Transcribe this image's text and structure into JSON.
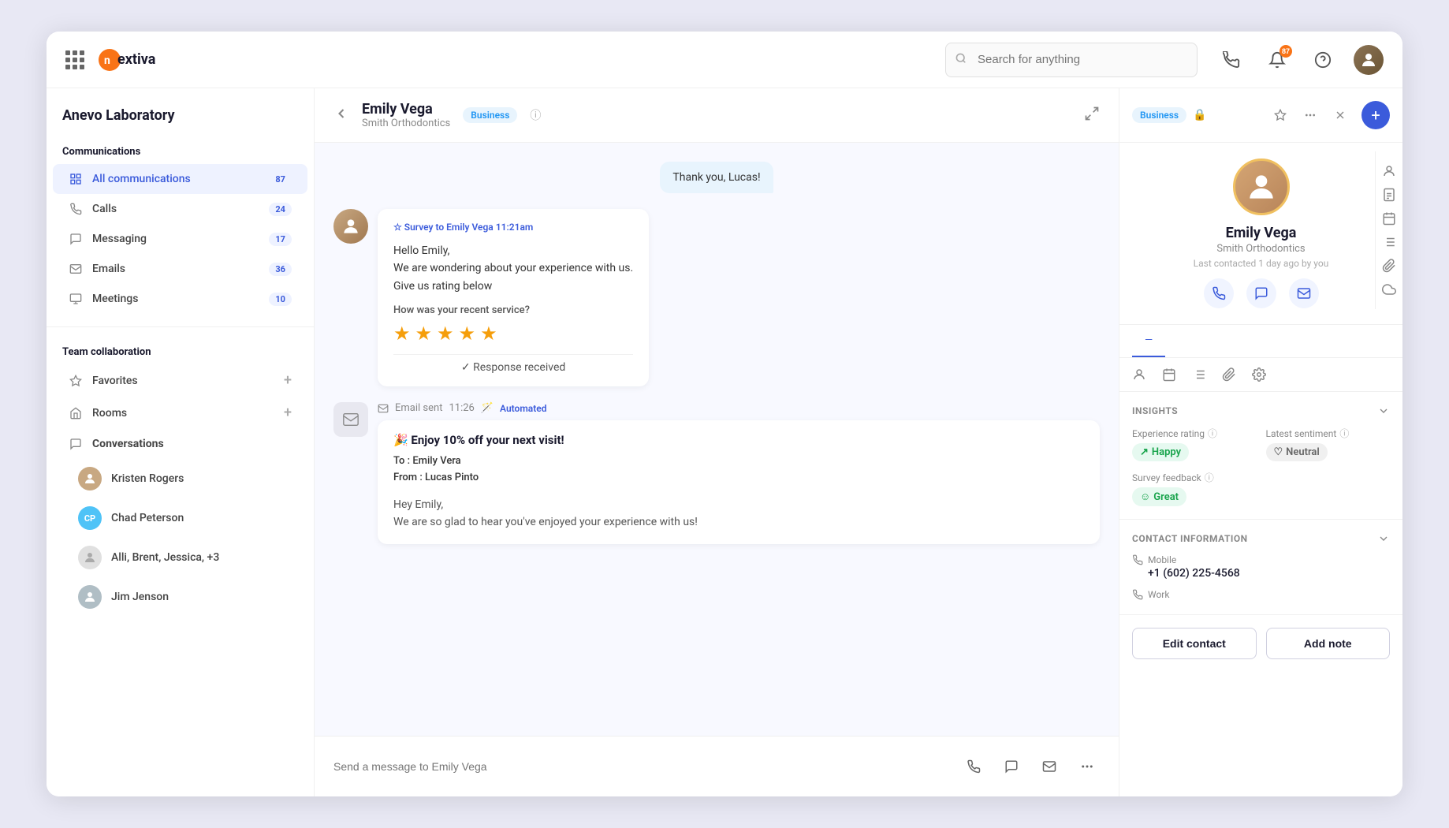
{
  "app": {
    "logo_text_start": "ne",
    "logo_text_orange": "x",
    "logo_text_end": "tiva"
  },
  "topnav": {
    "search_placeholder": "Search for anything",
    "notification_count": "87"
  },
  "sidebar": {
    "workspace": "Anevo Laboratory",
    "communications_title": "Communications",
    "items_comm": [
      {
        "label": "All communications",
        "badge": "87",
        "active": true
      },
      {
        "label": "Calls",
        "badge": "24"
      },
      {
        "label": "Messaging",
        "badge": "17"
      },
      {
        "label": "Emails",
        "badge": "36"
      },
      {
        "label": "Meetings",
        "badge": "10"
      }
    ],
    "team_collab_title": "Team collaboration",
    "favorites_label": "Favorites",
    "rooms_label": "Rooms",
    "conversations_label": "Conversations",
    "conversations": [
      {
        "name": "Kristen Rogers",
        "avatar_color": "#c8a882",
        "avatar_type": "image"
      },
      {
        "name": "Chad Peterson",
        "avatar_color": "#4fc3f7",
        "avatar_type": "initials",
        "initials": "CP"
      },
      {
        "name": "Alli, Brent, Jessica, +3",
        "avatar_type": "image"
      },
      {
        "name": "Jim Jenson",
        "avatar_type": "image"
      }
    ]
  },
  "chat": {
    "contact_name": "Emily Vega",
    "contact_org": "Smith Orthodontics",
    "business_label": "Business",
    "msg_outgoing": "Thank you, Lucas!",
    "survey_label": "Survey to",
    "survey_to": "Emily Vega",
    "survey_time": "11:21am",
    "survey_greeting": "Hello Emily,",
    "survey_line1": "We are wondering about your experience with us.",
    "survey_line2": "Give us rating below",
    "survey_question": "How was your recent service?",
    "stars_count": 5,
    "response_received": "✓ Response received",
    "email_label": "Email sent",
    "email_time": "11:26",
    "automated_label": "Automated",
    "email_subject": "🎉 Enjoy 10% off your next visit!",
    "email_to_label": "To :",
    "email_to": "Emily Vera",
    "email_from_label": "From :",
    "email_from": "Lucas Pinto",
    "email_body_line1": "Hey Emily,",
    "email_body_line2": "We are so glad to hear you've enjoyed your experience with us!",
    "input_placeholder": "Send a message to Emily Vega"
  },
  "right_panel": {
    "business_label": "Business",
    "contact_name": "Emily Vega",
    "contact_org": "Smith Orthodontics",
    "last_contacted": "Last contacted 1 day ago by you",
    "insights_title": "INSIGHTS",
    "experience_rating_label": "Experience rating",
    "experience_rating_value": "Happy",
    "latest_sentiment_label": "Latest sentiment",
    "latest_sentiment_value": "Neutral",
    "survey_feedback_label": "Survey feedback",
    "survey_feedback_value": "Great",
    "contact_info_title": "CONTACT INFORMATION",
    "mobile_label": "Mobile",
    "mobile_value": "+1 (602) 225-4568",
    "work_label": "Work",
    "edit_contact_label": "Edit contact",
    "add_note_label": "Add note"
  }
}
